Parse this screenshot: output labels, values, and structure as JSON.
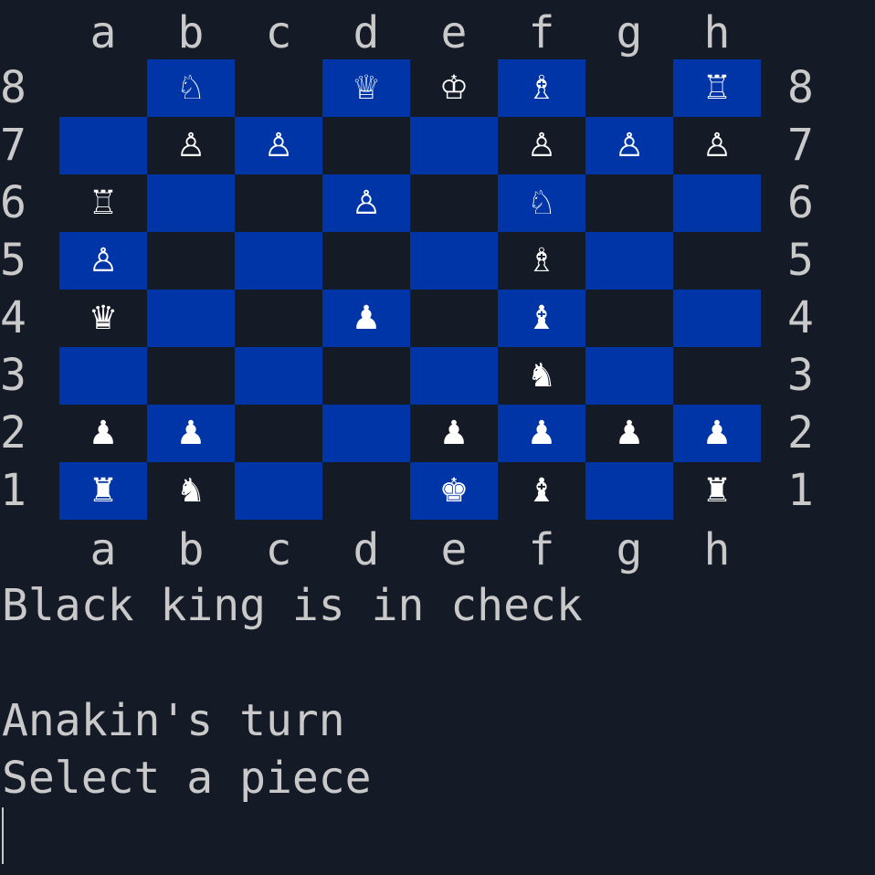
{
  "files": [
    "a",
    "b",
    "c",
    "d",
    "e",
    "f",
    "g",
    "h"
  ],
  "ranks": [
    "8",
    "7",
    "6",
    "5",
    "4",
    "3",
    "2",
    "1"
  ],
  "colors": {
    "background": "#151a27",
    "light_square": "#0035a8",
    "text": "#c9c9c9",
    "piece": "#ffffff"
  },
  "board": [
    [
      "",
      "♘",
      "",
      "♕",
      "♔",
      "♗",
      "",
      "♖"
    ],
    [
      "",
      "♙",
      "♙",
      "",
      "",
      "♙",
      "♙",
      "♙"
    ],
    [
      "♖",
      "",
      "",
      "♙",
      "",
      "♘",
      "",
      ""
    ],
    [
      "♙",
      "",
      "",
      "",
      "",
      "♗",
      "",
      ""
    ],
    [
      "♛",
      "",
      "",
      "♟",
      "",
      "♝",
      "",
      ""
    ],
    [
      "",
      "",
      "",
      "",
      "",
      "♞",
      "",
      ""
    ],
    [
      "♟",
      "♟",
      "",
      "",
      "♟",
      "♟",
      "♟",
      "♟"
    ],
    [
      "♜",
      "♞",
      "",
      "",
      "♚",
      "♝",
      "",
      "♜"
    ]
  ],
  "status": {
    "check_message": "Black king is in check",
    "blank_line": "",
    "turn_message": "Anakin's turn",
    "prompt": "Select a piece"
  }
}
